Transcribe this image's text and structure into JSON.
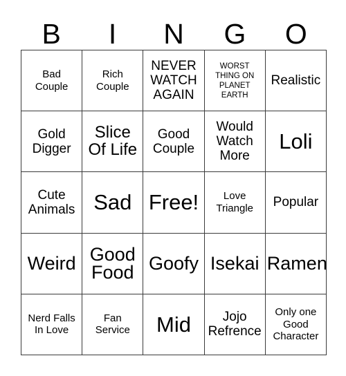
{
  "card": {
    "header_letters": [
      "B",
      "I",
      "N",
      "G",
      "O"
    ],
    "columns": 5,
    "rows": 5,
    "colors": {
      "background": "#ffffff",
      "text": "#000000",
      "grid_line": "#3a3a3a"
    },
    "cells": [
      {
        "text": "Bad\nCouple",
        "size": "s",
        "free": false
      },
      {
        "text": "Rich\nCouple",
        "size": "s",
        "free": false
      },
      {
        "text": "NEVER\nWATCH\nAGAIN",
        "size": "m",
        "free": false
      },
      {
        "text": "WORST\nTHING ON\nPLANET\nEARTH",
        "size": "xs",
        "free": false
      },
      {
        "text": "Realistic",
        "size": "m",
        "free": false
      },
      {
        "text": "Gold\nDigger",
        "size": "m",
        "free": false
      },
      {
        "text": "Slice\nOf Life",
        "size": "l",
        "free": false
      },
      {
        "text": "Good\nCouple",
        "size": "m",
        "free": false
      },
      {
        "text": "Would\nWatch\nMore",
        "size": "m",
        "free": false
      },
      {
        "text": "Loli",
        "size": "xxl",
        "free": false
      },
      {
        "text": "Cute\nAnimals",
        "size": "m",
        "free": false
      },
      {
        "text": "Sad",
        "size": "xxl",
        "free": false
      },
      {
        "text": "Free!",
        "size": "xxl",
        "free": true
      },
      {
        "text": "Love\nTriangle",
        "size": "s",
        "free": false
      },
      {
        "text": "Popular",
        "size": "m",
        "free": false
      },
      {
        "text": "Weird",
        "size": "xl",
        "free": false
      },
      {
        "text": "Good\nFood",
        "size": "xl",
        "free": false
      },
      {
        "text": "Goofy",
        "size": "xl",
        "free": false
      },
      {
        "text": "Isekai",
        "size": "xl",
        "free": false
      },
      {
        "text": "Ramen",
        "size": "xl",
        "free": false
      },
      {
        "text": "Nerd Falls\nIn Love",
        "size": "s",
        "free": false
      },
      {
        "text": "Fan\nService",
        "size": "s",
        "free": false
      },
      {
        "text": "Mid",
        "size": "xxl",
        "free": false
      },
      {
        "text": "Jojo\nRefrence",
        "size": "m",
        "free": false
      },
      {
        "text": "Only one\nGood\nCharacter",
        "size": "s",
        "free": false
      }
    ]
  }
}
